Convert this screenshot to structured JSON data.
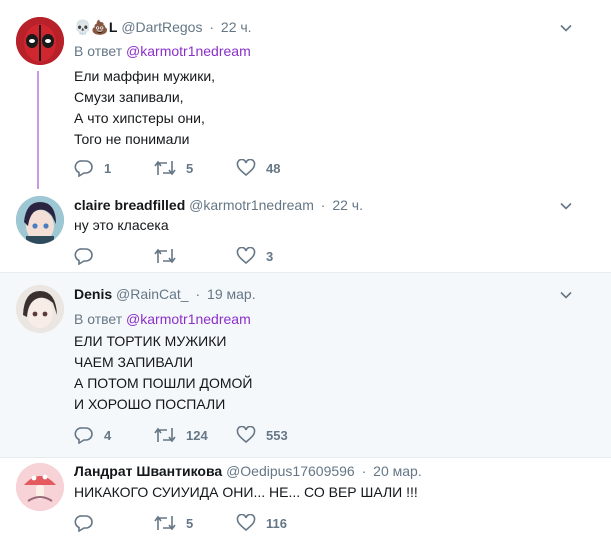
{
  "tweets": [
    {
      "name": "💀💩L",
      "handle": "@DartRegos",
      "time": "22 ч.",
      "reply_prefix": "В ответ",
      "reply_to": "@karmotr1nedream",
      "text": "Ели маффин мужики,\nСмузи запивали,\nА что хипстеры они,\nТого не понимали",
      "replies": "1",
      "retweets": "5",
      "likes": "48"
    },
    {
      "name": "claire breadfilled",
      "handle": "@karmotr1nedream",
      "time": "22 ч.",
      "text": "ну это класека",
      "replies": "",
      "retweets": "",
      "likes": "3"
    },
    {
      "name": "Denis",
      "handle": "@RainCat_",
      "time": "19 мар.",
      "reply_prefix": "В ответ",
      "reply_to": "@karmotr1nedream",
      "text": "ЕЛИ ТОРТИК МУЖИКИ\nЧАЕМ ЗАПИВАЛИ\nА ПОТОМ ПОШЛИ ДОМОЙ\nИ ХОРОШО ПОСПАЛИ",
      "replies": "4",
      "retweets": "124",
      "likes": "553"
    },
    {
      "name": "Ландрат Швантикова",
      "handle": "@Oedipus17609596",
      "time": "20 мар.",
      "text": "НИКАКОГО СУИУИДА ОНИ... НЕ... СО ВЕР ШАЛИ !!!",
      "replies": "",
      "retweets": "5",
      "likes": "116"
    }
  ],
  "colors": {
    "accent_purple": "#8b2fc9",
    "thread_line": "#c99be5",
    "muted": "#657786",
    "alt_bg": "#f5f8fa"
  }
}
